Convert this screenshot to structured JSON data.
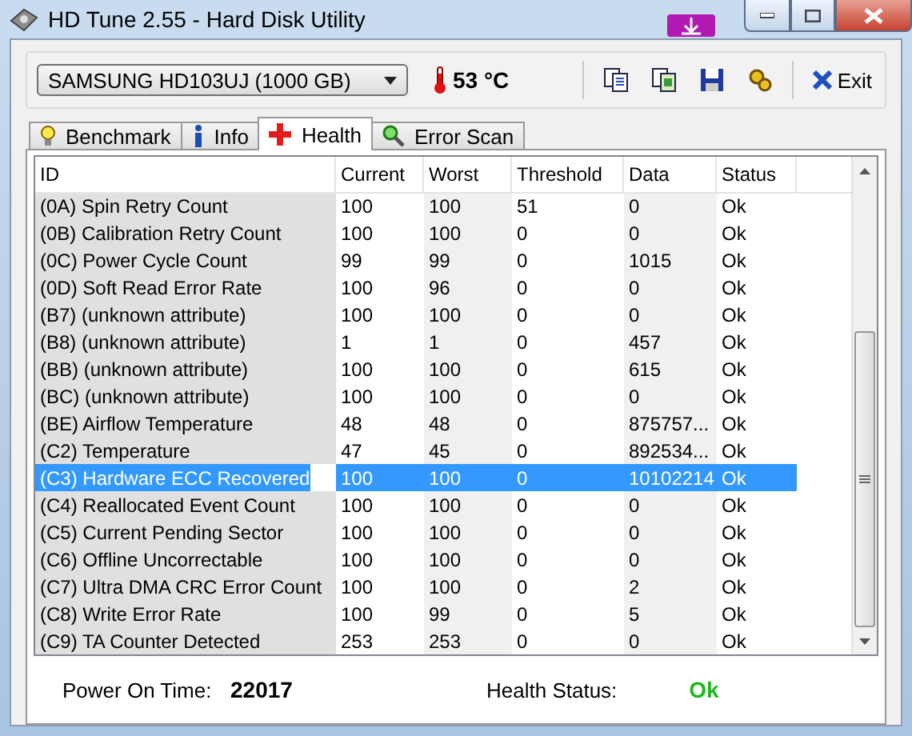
{
  "window": {
    "title": "HD Tune 2.55 - Hard Disk Utility"
  },
  "drive": {
    "value": "SAMSUNG HD103UJ (1000 GB)"
  },
  "temperature": "53 °C",
  "exit_button": "Exit",
  "tabs": [
    {
      "label": "Benchmark",
      "selected": false,
      "kind": "bulb"
    },
    {
      "label": "Info",
      "selected": false,
      "kind": "info"
    },
    {
      "label": "Health",
      "selected": true,
      "kind": "cross"
    },
    {
      "label": "Error Scan",
      "selected": false,
      "kind": "magnifier"
    }
  ],
  "table": {
    "columns": [
      "ID",
      "Current",
      "Worst",
      "Threshold",
      "Data",
      "Status"
    ],
    "rows": [
      {
        "cells": [
          "(0A) Spin Retry Count",
          "100",
          "100",
          "51",
          "0",
          "Ok"
        ],
        "selected": false
      },
      {
        "cells": [
          "(0B) Calibration Retry Count",
          "100",
          "100",
          "0",
          "0",
          "Ok"
        ],
        "selected": false
      },
      {
        "cells": [
          "(0C) Power Cycle Count",
          "99",
          "99",
          "0",
          "1015",
          "Ok"
        ],
        "selected": false
      },
      {
        "cells": [
          "(0D) Soft Read Error Rate",
          "100",
          "96",
          "0",
          "0",
          "Ok"
        ],
        "selected": false
      },
      {
        "cells": [
          "(B7) (unknown attribute)",
          "100",
          "100",
          "0",
          "0",
          "Ok"
        ],
        "selected": false
      },
      {
        "cells": [
          "(B8) (unknown attribute)",
          "1",
          "1",
          "0",
          "457",
          "Ok"
        ],
        "selected": false
      },
      {
        "cells": [
          "(BB) (unknown attribute)",
          "100",
          "100",
          "0",
          "615",
          "Ok"
        ],
        "selected": false
      },
      {
        "cells": [
          "(BC) (unknown attribute)",
          "100",
          "100",
          "0",
          "0",
          "Ok"
        ],
        "selected": false
      },
      {
        "cells": [
          "(BE) Airflow Temperature",
          "48",
          "48",
          "0",
          "875757...",
          "Ok"
        ],
        "selected": false
      },
      {
        "cells": [
          "(C2) Temperature",
          "47",
          "45",
          "0",
          "892534...",
          "Ok"
        ],
        "selected": false
      },
      {
        "cells": [
          "(C3) Hardware ECC Recovered",
          "100",
          "100",
          "0",
          "10102214",
          "Ok"
        ],
        "selected": true
      },
      {
        "cells": [
          "(C4) Reallocated Event Count",
          "100",
          "100",
          "0",
          "0",
          "Ok"
        ],
        "selected": false
      },
      {
        "cells": [
          "(C5) Current Pending Sector",
          "100",
          "100",
          "0",
          "0",
          "Ok"
        ],
        "selected": false
      },
      {
        "cells": [
          "(C6) Offline Uncorrectable",
          "100",
          "100",
          "0",
          "0",
          "Ok"
        ],
        "selected": false
      },
      {
        "cells": [
          "(C7) Ultra DMA CRC Error Count",
          "100",
          "100",
          "0",
          "2",
          "Ok"
        ],
        "selected": false
      },
      {
        "cells": [
          "(C8) Write Error Rate",
          "100",
          "99",
          "0",
          "5",
          "Ok"
        ],
        "selected": false
      },
      {
        "cells": [
          "(C9) TA Counter Detected",
          "253",
          "253",
          "0",
          "0",
          "Ok"
        ],
        "selected": false
      }
    ]
  },
  "footer": {
    "power_on_label": "Power On Time:",
    "power_on_value": "22017",
    "health_label": "Health Status:",
    "health_value": "Ok"
  }
}
